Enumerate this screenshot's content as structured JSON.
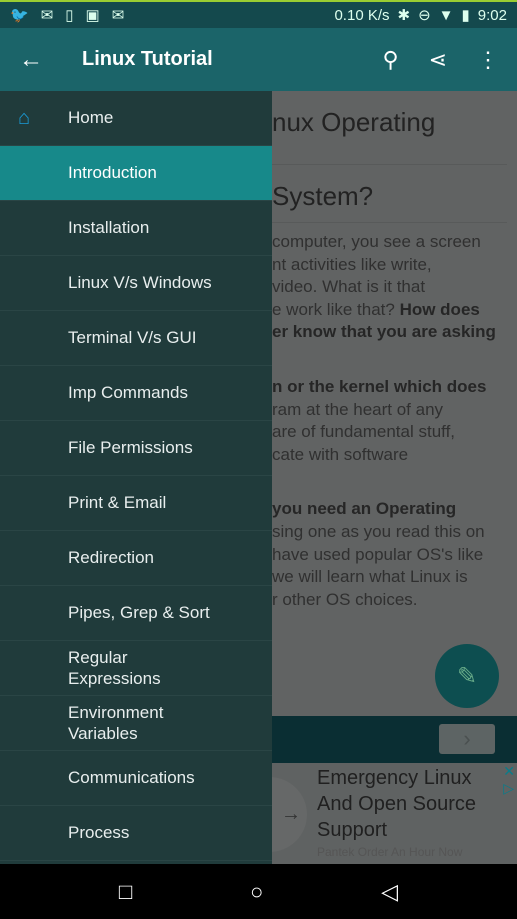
{
  "status": {
    "icons": [
      "twitter-icon",
      "mail-icon",
      "phone-icon",
      "image-icon",
      "email-icon"
    ],
    "speed": "0.10 K/s",
    "time": "9:02"
  },
  "appbar": {
    "title": "Linux Tutorial"
  },
  "content": {
    "heading1": "nux Operating",
    "heading2": "System?",
    "para1": [
      "computer, you see a screen",
      "nt activities like write,",
      "video. What is it that",
      "e work like that? ",
      "er know that you are asking"
    ],
    "para1_bold": "How does",
    "para2_bold": "n or the kernel which does",
    "para2": [
      "ram at the heart of any",
      "are of fundamental stuff,",
      "cate with software"
    ],
    "para3_bold": "you need an Operating",
    "para3": [
      "sing one as you read this on",
      "have used popular OS's like",
      "we will learn what Linux is",
      "r other OS choices."
    ]
  },
  "ad": {
    "lines": [
      "Emergency Linux",
      "And Open Source",
      "Support"
    ],
    "sub": "Pantek Order An Hour Now"
  },
  "drawer": {
    "items": [
      "Home",
      "Introduction",
      "Installation",
      "Linux V/s Windows",
      "Terminal V/s GUI",
      "Imp Commands",
      "File Permissions",
      "Print & Email",
      "Redirection",
      "Pipes, Grep & Sort",
      "Regular Expressions",
      "Environment Variables",
      "Communications",
      "Process"
    ],
    "selected": "Introduction"
  },
  "colors": {
    "appbar": "#1b6469",
    "selected": "#17898a",
    "drawer": "#203b3b"
  }
}
